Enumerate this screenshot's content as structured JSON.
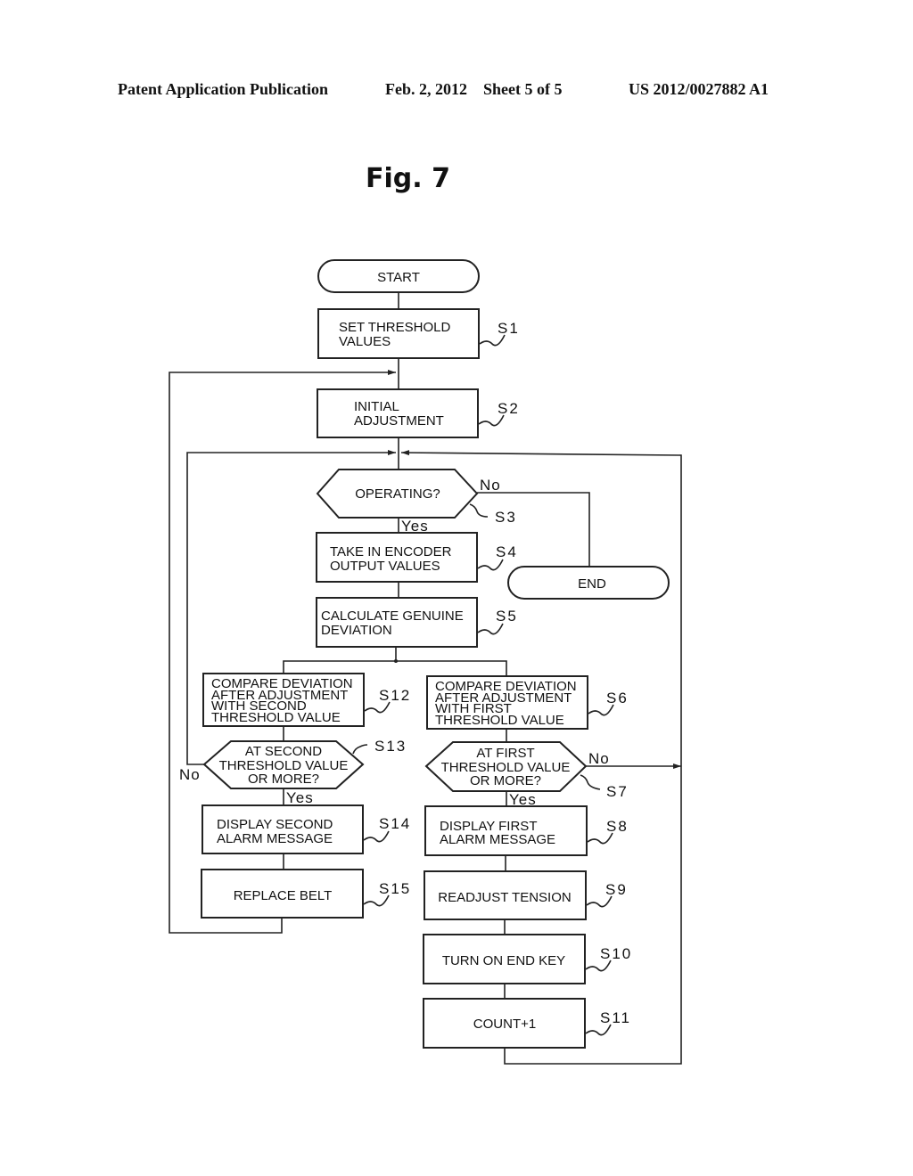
{
  "header": {
    "left": "Patent Application Publication",
    "middle": "Feb. 2, 2012    Sheet 5 of 5",
    "right": "US 2012/0027882 A1"
  },
  "figure": {
    "title": "Fig. 7"
  },
  "nodes": {
    "start": {
      "lines": [
        "START"
      ]
    },
    "s1": {
      "step": "S1",
      "lines": [
        "SET THRESHOLD",
        "VALUES"
      ]
    },
    "s2": {
      "step": "S2",
      "lines": [
        "INITIAL",
        "ADJUSTMENT"
      ]
    },
    "s3": {
      "step": "S3",
      "lines": [
        "OPERATING?"
      ]
    },
    "s4": {
      "step": "S4",
      "lines": [
        "TAKE IN ENCODER",
        "OUTPUT VALUES"
      ]
    },
    "end": {
      "lines": [
        "END"
      ]
    },
    "s5": {
      "step": "S5",
      "lines": [
        "CALCULATE GENUINE",
        "DEVIATION"
      ]
    },
    "s6": {
      "step": "S6",
      "lines": [
        "COMPARE DEVIATION",
        "AFTER ADJUSTMENT",
        "WITH FIRST",
        "THRESHOLD VALUE"
      ]
    },
    "s7": {
      "step": "S7",
      "lines": [
        "AT FIRST",
        "THRESHOLD VALUE",
        "OR MORE?"
      ]
    },
    "s8": {
      "step": "S8",
      "lines": [
        "DISPLAY FIRST",
        "ALARM MESSAGE"
      ]
    },
    "s9": {
      "step": "S9",
      "lines": [
        "READJUST TENSION"
      ]
    },
    "s10": {
      "step": "S10",
      "lines": [
        "TURN ON END KEY"
      ]
    },
    "s11": {
      "step": "S11",
      "lines": [
        "COUNT+1"
      ]
    },
    "s12": {
      "step": "S12",
      "lines": [
        "COMPARE DEVIATION",
        "AFTER ADJUSTMENT",
        "WITH SECOND",
        "THRESHOLD VALUE"
      ]
    },
    "s13": {
      "step": "S13",
      "lines": [
        "AT SECOND",
        "THRESHOLD VALUE",
        "OR MORE?"
      ]
    },
    "s14": {
      "step": "S14",
      "lines": [
        "DISPLAY SECOND",
        "ALARM MESSAGE"
      ]
    },
    "s15": {
      "step": "S15",
      "lines": [
        "REPLACE BELT"
      ]
    }
  },
  "branch_labels": {
    "s3_no": "No",
    "s3_yes": "Yes",
    "s7_no": "No",
    "s7_yes": "Yes",
    "s13_no": "No",
    "s13_yes": "Yes"
  }
}
